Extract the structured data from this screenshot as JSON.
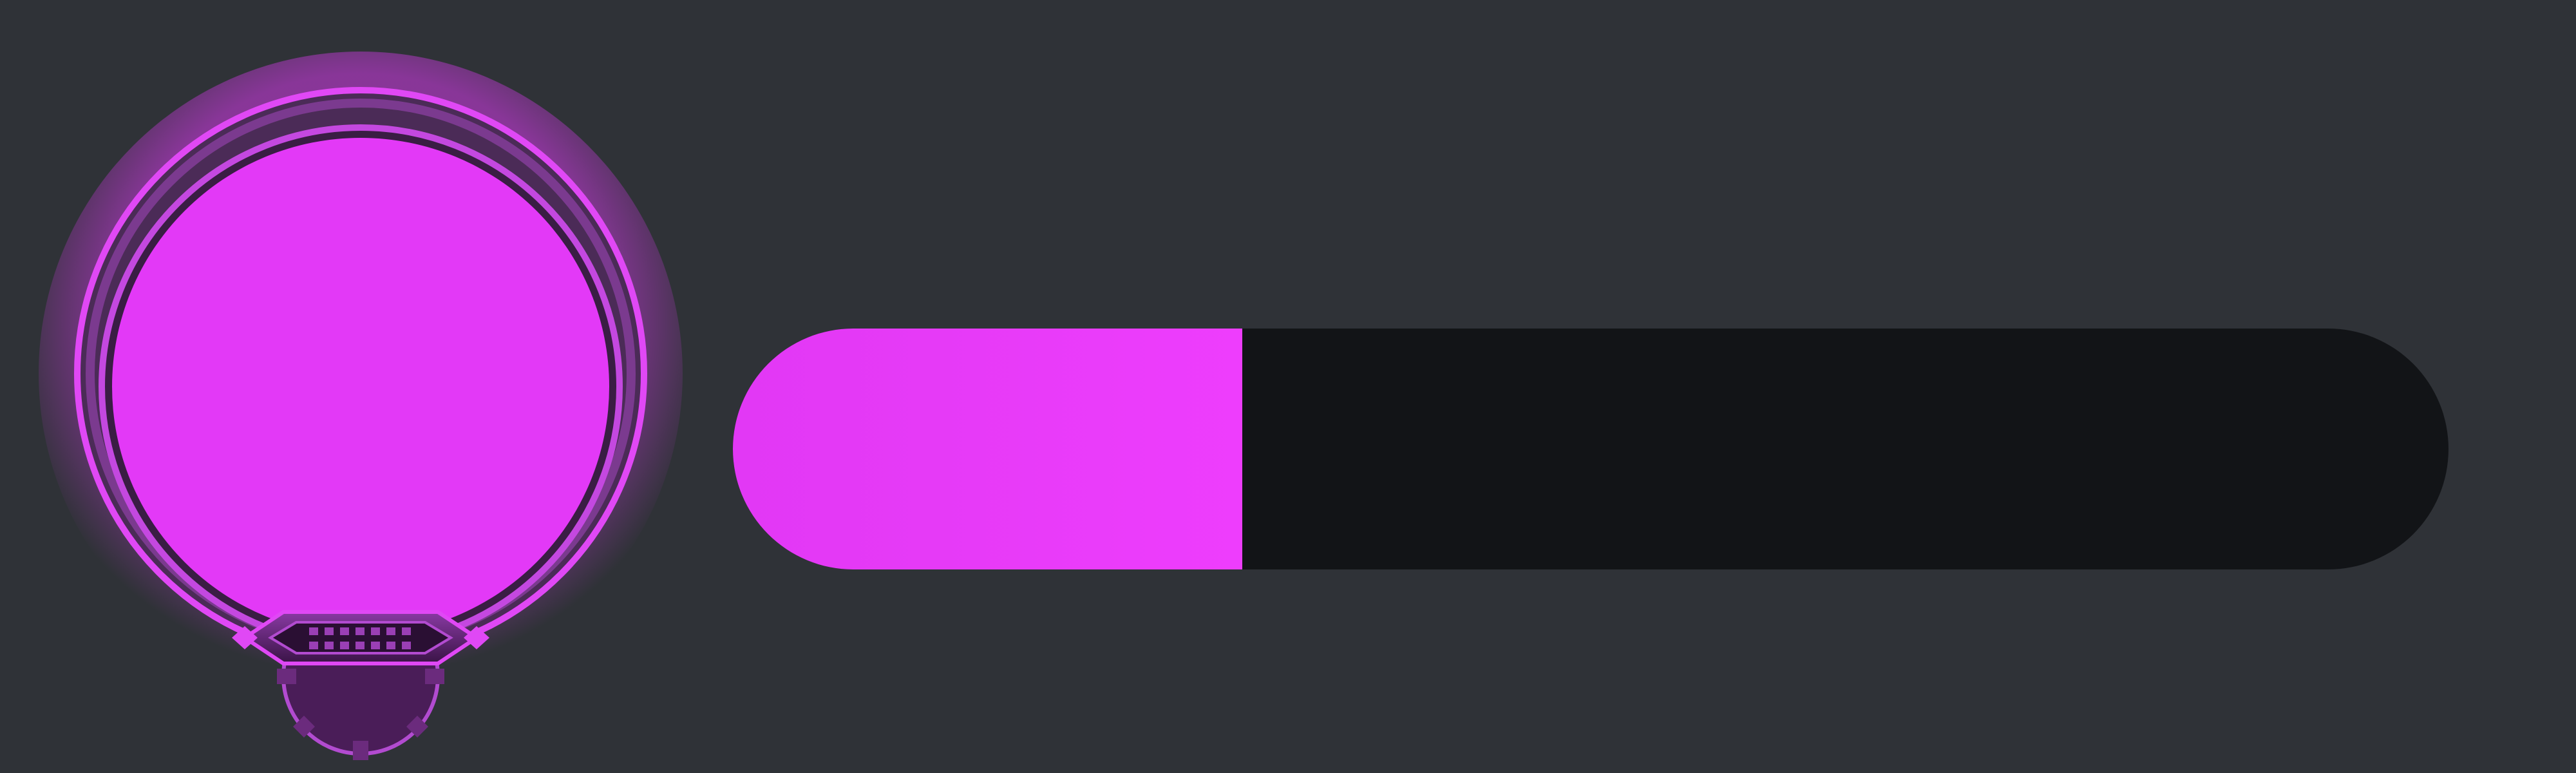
{
  "hud": {
    "portrait": {
      "icon": "avatar-frame-icon",
      "accent_color": "#e339f7",
      "frame_color": "#5d2a6b"
    },
    "progress_bar": {
      "fraction": 0.297,
      "fill_color": "#e83bf9",
      "track_color": "#121417"
    }
  },
  "colors": {
    "background": "#2f3237"
  }
}
